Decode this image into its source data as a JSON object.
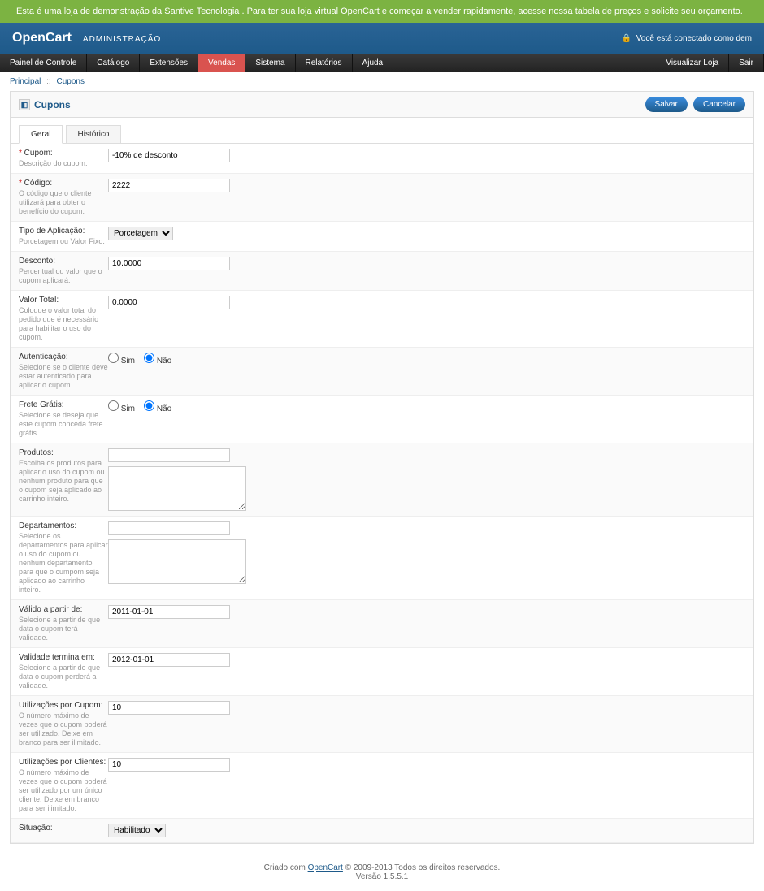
{
  "banner": {
    "text1": "Esta é uma loja de demonstração da",
    "link1": "Santive Tecnologia",
    "text2": ". Para ter sua loja virtual OpenCart e começar a vender rapidamente, acesse nossa",
    "link2": "tabela de preços",
    "text3": "e solicite seu orçamento."
  },
  "header": {
    "brand": "OpenCart",
    "sub": "ADMINISTRAÇÃO",
    "login_status": "Você está conectado como dem"
  },
  "menu": {
    "items": [
      "Painel de Controle",
      "Catálogo",
      "Extensões",
      "Vendas",
      "Sistema",
      "Relatórios",
      "Ajuda"
    ],
    "active": 3,
    "right": [
      "Visualizar Loja",
      "Sair"
    ]
  },
  "breadcrumb": {
    "items": [
      "Principal",
      "Cupons"
    ]
  },
  "page": {
    "title": "Cupons",
    "save": "Salvar",
    "cancel": "Cancelar"
  },
  "tabs": [
    "Geral",
    "Histórico"
  ],
  "fields": {
    "cupom": {
      "label": "Cupom:",
      "help": "Descrição do cupom.",
      "value": "-10% de desconto",
      "required": true
    },
    "codigo": {
      "label": "Código:",
      "help": "O código que o cliente utilizará para obter o benefício do cupom.",
      "value": "2222",
      "required": true
    },
    "tipo": {
      "label": "Tipo de Aplicação:",
      "help": "Porcetagem ou Valor Fixo.",
      "value": "Porcetagem"
    },
    "desconto": {
      "label": "Desconto:",
      "help": "Percentual ou valor que o cupom aplicará.",
      "value": "10.0000"
    },
    "valor_total": {
      "label": "Valor Total:",
      "help": "Coloque o valor total do pedido que é necessário para habilitar o uso do cupom.",
      "value": "0.0000"
    },
    "autenticacao": {
      "label": "Autenticação:",
      "help": "Selecione se o cliente deve estar autenticado para aplicar o cupom.",
      "sim": "Sim",
      "nao": "Não",
      "value": "nao"
    },
    "frete": {
      "label": "Frete Grátis:",
      "help": "Selecione se deseja que este cupom conceda frete grátis.",
      "sim": "Sim",
      "nao": "Não",
      "value": "nao"
    },
    "produtos": {
      "label": "Produtos:",
      "help": "Escolha os produtos para aplicar o uso do cupom ou nenhum produto para que o cupom seja aplicado ao carrinho inteiro."
    },
    "departamentos": {
      "label": "Departamentos:",
      "help": "Selecione os departamentos para aplicar o uso do cupom ou nenhum departamento para que o cumpom seja aplicado ao carrinho inteiro."
    },
    "valido_de": {
      "label": "Válido a partir de:",
      "help": "Selecione a partir de que data o cupom terá validade.",
      "value": "2011-01-01"
    },
    "valido_ate": {
      "label": "Validade termina em:",
      "help": "Selecione a partir de que data o cupom perderá a validade.",
      "value": "2012-01-01"
    },
    "util_cupom": {
      "label": "Utilizações por Cupom:",
      "help": "O número máximo de vezes que o cupom poderá ser utilizado. Deixe em branco para ser ilimitado.",
      "value": "10"
    },
    "util_cliente": {
      "label": "Utilizações por Clientes:",
      "help": "O número máximo de vezes que o cupom poderá ser utilizado por um único cliente. Deixe em branco para ser ilimitado.",
      "value": "10"
    },
    "situacao": {
      "label": "Situação:",
      "value": "Habilitado"
    }
  },
  "footer": {
    "text1": "Criado com ",
    "link": "OpenCart",
    "text2": " © 2009-2013 Todos os direitos reservados.",
    "version": "Versão 1.5.5.1"
  }
}
